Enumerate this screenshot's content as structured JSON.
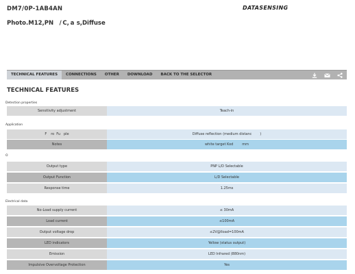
{
  "header": {
    "product_code": "DM7/0P-1AB4AN",
    "brand": "DATASENSING",
    "subtitle": "Photo.M12,PN     / C, a  s,Diffuse"
  },
  "navbar": {
    "tabs": [
      "TECHNICAL FEATURES",
      "CONNECTIONS",
      "OTHER",
      "DOWNLOAD",
      "BACK TO THE SELECTOR"
    ],
    "icons": [
      "download-icon",
      "mail-icon",
      "share-icon"
    ]
  },
  "section_title": "TECHNICAL FEATURES",
  "groups": [
    {
      "label": "Detection properties",
      "rows": [
        {
          "key": "Sensitivity adjustment",
          "value": "Teach-in"
        }
      ]
    },
    {
      "label": "Application",
      "rows": [
        {
          "key": "F      ro   Fu     ple",
          "value": "Diffuse reflection (medium distanc            )"
        },
        {
          "key": "Notes",
          "value": "white target Kod             mm"
        }
      ]
    },
    {
      "label": "O         ",
      "rows": [
        {
          "key": "Output type",
          "value": "PNP L/D Selectable"
        },
        {
          "key": "Output Function",
          "value": "L/D Selectable"
        },
        {
          "key": "Response time",
          "value": "1.25ms"
        }
      ]
    },
    {
      "label": "Electrical data",
      "rows": [
        {
          "key": "No-Load supply current",
          "value": "≤ 30mA"
        },
        {
          "key": "Load current",
          "value": "≤100mA"
        },
        {
          "key": "Output voltage drop",
          "value": "≤2V@Iload=100mA"
        },
        {
          "key": "LED indicators",
          "value": "Yellow (status output)"
        },
        {
          "key": "Emission",
          "value": "LED Infrared (880nm)"
        },
        {
          "key": "Impulsive Overvoltage Protection",
          "value": "Yes"
        }
      ]
    }
  ]
}
